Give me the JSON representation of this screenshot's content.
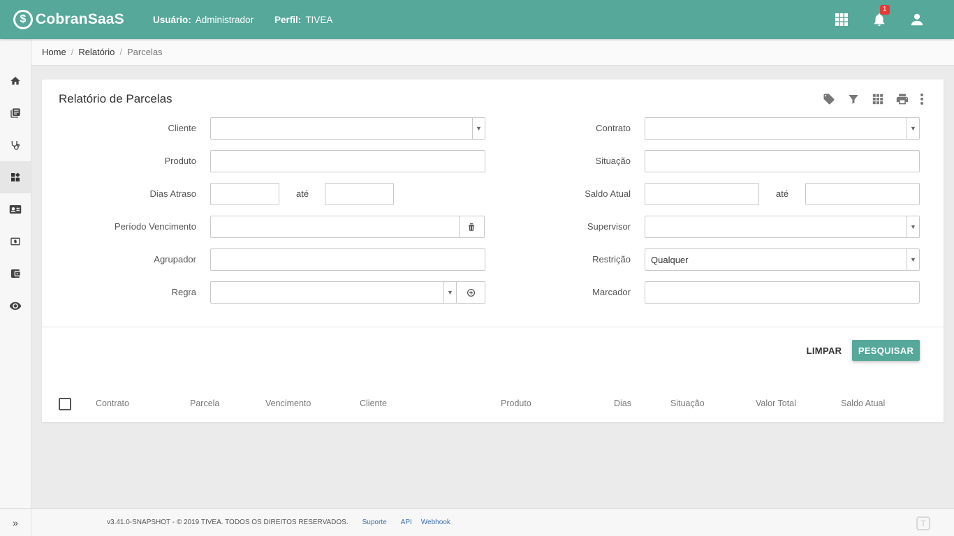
{
  "app": {
    "logo_symbol": "$",
    "name": "CobranSaaS",
    "user_label": "Usuário:",
    "user_value": "Administrador",
    "profile_label": "Perfil:",
    "profile_value": "TIVEA",
    "notification_count": "1"
  },
  "breadcrumb": {
    "home": "Home",
    "relatorio": "Relatório",
    "current": "Parcelas"
  },
  "form": {
    "title": "Relatório de Parcelas",
    "left": {
      "cliente": "Cliente",
      "produto": "Produto",
      "dias_atraso": "Dias Atraso",
      "ate": "até",
      "periodo_vencimento": "Período Vencimento",
      "agrupador": "Agrupador",
      "regra": "Regra"
    },
    "right": {
      "contrato": "Contrato",
      "situacao": "Situação",
      "saldo_atual": "Saldo Atual",
      "ate": "até",
      "supervisor": "Supervisor",
      "restricao": "Restrição",
      "restricao_value": "Qualquer",
      "marcador": "Marcador"
    },
    "buttons": {
      "limpar": "LIMPAR",
      "pesquisar": "PESQUISAR"
    }
  },
  "table": {
    "columns": [
      "Contrato",
      "Parcela",
      "Vencimento",
      "Cliente",
      "Produto",
      "Dias",
      "Situação",
      "Valor Total",
      "Saldo Atual"
    ]
  },
  "footer": {
    "copyright": "v3.41.0-SNAPSHOT - © 2019 TIVEA. TODOS OS DIREITOS RESERVADOS.",
    "links": [
      "Suporte",
      "API",
      "Webhook"
    ],
    "logo_letter": "T"
  },
  "icons": {
    "sidenav": [
      "home-icon",
      "book-icon",
      "stethoscope-icon",
      "dashboard-icon",
      "contact-card-icon",
      "money-icon",
      "wallet-icon",
      "eye-icon"
    ],
    "toolbar": [
      "tag-icon",
      "filter-icon",
      "grid-icon",
      "print-icon",
      "more-vert-icon"
    ]
  },
  "colors": {
    "primary": "#55a89a",
    "badge": "#e53935"
  }
}
